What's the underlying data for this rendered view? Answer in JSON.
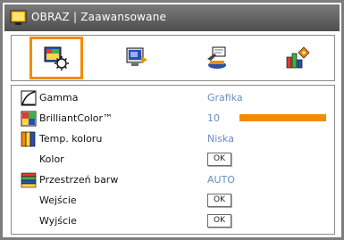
{
  "window": {
    "title": "OBRAZ | Zaawansowane",
    "title_icon": "screen-icon"
  },
  "tabs": [
    {
      "name": "image-settings",
      "icon": "image-settings-icon",
      "active": true
    },
    {
      "name": "display",
      "icon": "display-icon",
      "active": false
    },
    {
      "name": "setup",
      "icon": "setup-icon",
      "active": false
    },
    {
      "name": "options",
      "icon": "options-icon",
      "active": false
    }
  ],
  "menu": {
    "gamma": {
      "label": "Gamma",
      "value": "Grafika",
      "icon": "gamma-icon"
    },
    "brilliantcolor": {
      "label": "BrilliantColor™",
      "value": "10",
      "level": 1.0,
      "icon": "brilliantcolor-icon"
    },
    "color_temp": {
      "label": "Temp. koloru",
      "value": "Niska",
      "icon": "color-temp-icon"
    },
    "color": {
      "label": "Kolor",
      "button": "OK"
    },
    "color_space": {
      "label": "Przestrzeń barw",
      "value": "AUTO",
      "icon": "color-space-icon"
    },
    "input": {
      "label": "Wejście",
      "button": "OK"
    },
    "output": {
      "label": "Wyjście",
      "button": "OK"
    }
  },
  "colors": {
    "accent": "#f28c00",
    "value_text": "#6a8dc4",
    "titlebar": "#5f5f5f"
  }
}
